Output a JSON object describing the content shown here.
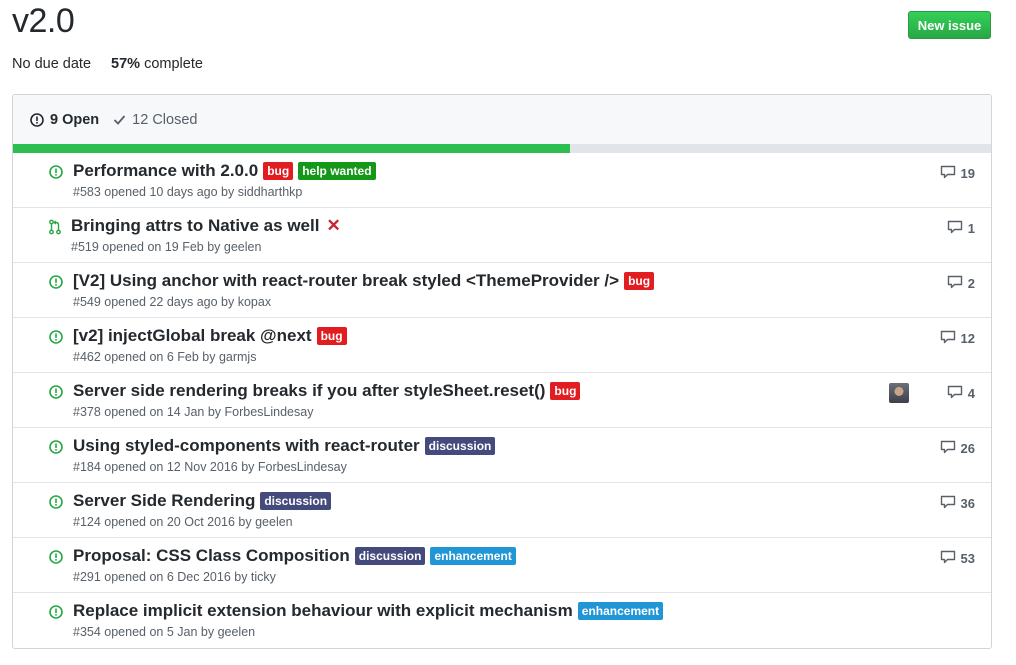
{
  "milestone": {
    "title": "v2.0",
    "due": "No due date",
    "percent": "57%",
    "complete_text": "complete",
    "progress_fraction": 0.57
  },
  "buttons": {
    "new_issue": "New issue"
  },
  "states": {
    "open": "9 Open",
    "closed": "12 Closed"
  },
  "colors": {
    "bug": "#e11d21",
    "help_wanted": "#159818",
    "discussion": "#444b7c",
    "enhancement": "#2196d6",
    "open_green": "#28a745",
    "progress": "#2cbe4e"
  },
  "issues": [
    {
      "title": "Performance with 2.0.0",
      "sub": "#583 opened 10 days ago by siddharthkp",
      "labels": [
        "bug",
        "help wanted"
      ],
      "comments": "19",
      "type": "issue"
    },
    {
      "title": "Bringing attrs to Native as well",
      "sub": "#519 opened on 19 Feb by geelen",
      "labels": [],
      "comments": "1",
      "type": "pr",
      "status": "✕"
    },
    {
      "title": "[V2] Using anchor with react-router break styled <ThemeProvider />",
      "sub": "#549 opened 22 days ago by kopax",
      "labels": [
        "bug"
      ],
      "comments": "2",
      "type": "issue"
    },
    {
      "title": "[v2] injectGlobal break @next",
      "sub": "#462 opened on 6 Feb by garmjs",
      "labels": [
        "bug"
      ],
      "comments": "12",
      "type": "issue"
    },
    {
      "title": "Server side rendering breaks if you after styleSheet.reset()",
      "sub": "#378 opened on 14 Jan by ForbesLindesay",
      "labels": [
        "bug"
      ],
      "comments": "4",
      "type": "issue",
      "avatar": true
    },
    {
      "title": "Using styled-components with react-router",
      "sub": "#184 opened on 12 Nov 2016 by ForbesLindesay",
      "labels": [
        "discussion"
      ],
      "comments": "26",
      "type": "issue"
    },
    {
      "title": "Server Side Rendering",
      "sub": "#124 opened on 20 Oct 2016 by geelen",
      "labels": [
        "discussion"
      ],
      "comments": "36",
      "type": "issue"
    },
    {
      "title": "Proposal: CSS Class Composition",
      "sub": "#291 opened on 6 Dec 2016 by ticky",
      "labels": [
        "discussion",
        "enhancement"
      ],
      "comments": "53",
      "type": "issue"
    },
    {
      "title": "Replace implicit extension behaviour with explicit mechanism",
      "sub": "#354 opened on 5 Jan by geelen",
      "labels": [
        "enhancement"
      ],
      "comments": "",
      "type": "issue"
    }
  ]
}
